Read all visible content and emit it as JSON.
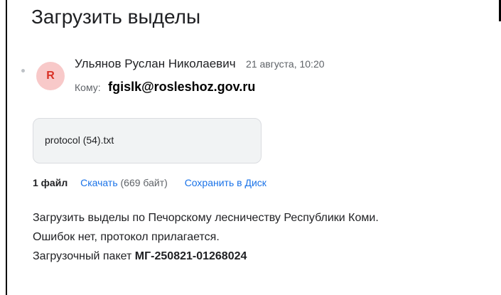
{
  "email": {
    "subject": "Загрузить выделы",
    "sender": {
      "avatar_letter": "R",
      "avatar_bg": "#f8c9c9",
      "avatar_fg": "#d93025",
      "name": "Ульянов Руслан Николаевич",
      "date": "21 августа, 10:20"
    },
    "to": {
      "label": "Кому:",
      "address": "fgislk@rosleshoz.gov.ru"
    },
    "attachment": {
      "filename": "protocol (54).txt"
    },
    "files": {
      "count_label": "1 файл",
      "download_label": "Скачать",
      "size_label": "(669 байт)",
      "save_to_drive_label": "Сохранить в Диск"
    },
    "body": {
      "line1": "Загрузить выделы по Печорскому лесничеству Республики Коми.",
      "line2": "Ошибок нет, протокол прилагается.",
      "line3_prefix": "Загрузочный пакет ",
      "line3_code": "МГ-250821-01268024"
    }
  },
  "colors": {
    "link": "#1a73e8",
    "secondary_text": "#5f6368"
  }
}
